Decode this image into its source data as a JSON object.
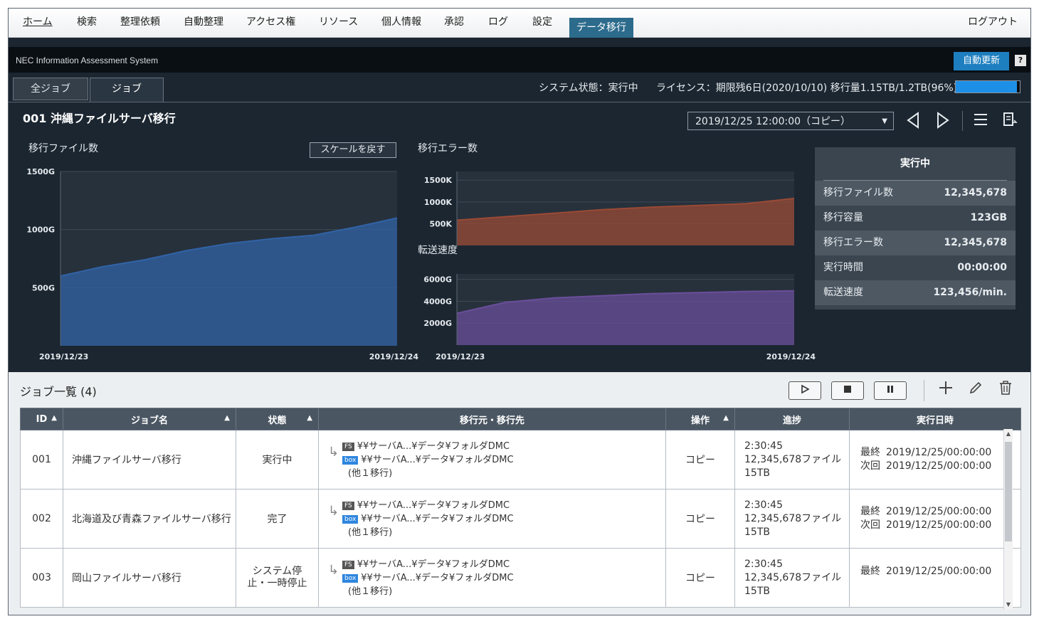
{
  "menu": {
    "items": [
      "ホーム",
      "検索",
      "整理依頼",
      "自動整理",
      "アクセス権",
      "リソース",
      "個人情報",
      "承認",
      "ログ",
      "設定",
      "データ移行"
    ],
    "active": "データ移行",
    "logout": "ログアウト"
  },
  "header": {
    "system_name": "NEC Information Assessment System",
    "auto_refresh": "自動更新",
    "help": "?",
    "tabs": [
      "全ジョブ",
      "ジョブ"
    ],
    "system_status": "システム状態：実行中",
    "license": "ライセンス：期限残6日(2020/10/10) 移行量1.15TB/1.2TB(96%)",
    "license_percent": 96
  },
  "job": {
    "title": "001 沖縄ファイルサーバ移行",
    "datetime_select": "2019/12/25 12:00:00（コピー）"
  },
  "charts": {
    "files_title": "移行ファイル数",
    "scale_reset": "スケールを戻す",
    "errors_title": "移行エラー数",
    "speed_title": "転送速度"
  },
  "chart_data": [
    {
      "type": "area",
      "title": "移行ファイル数",
      "x": [
        "2019/12/23",
        "",
        "",
        "",
        "",
        "",
        "",
        "",
        "2019/12/24"
      ],
      "yticks": [
        "500G",
        "1000G",
        "1500G"
      ],
      "ylim": [
        0,
        1500
      ],
      "series": [
        {
          "values": [
            600,
            680,
            740,
            820,
            880,
            920,
            950,
            1020,
            1100
          ]
        }
      ],
      "xtick_labels": [
        "2019/12/23",
        "2019/12/24"
      ],
      "color": "#3163a6"
    },
    {
      "type": "area",
      "title": "移行エラー数",
      "x": [
        "",
        "",
        "",
        "",
        "",
        "",
        "",
        ""
      ],
      "yticks": [
        "500K",
        "1000K",
        "1500K"
      ],
      "ylim": [
        0,
        1700
      ],
      "series": [
        {
          "values": [
            580,
            660,
            740,
            820,
            880,
            920,
            960,
            1080
          ]
        }
      ],
      "color": "#9a4a35"
    },
    {
      "type": "area",
      "title": "転送速度",
      "x": [
        "2019/12/23",
        "",
        "",
        "",
        "",
        "",
        "",
        "2019/12/24"
      ],
      "yticks": [
        "2000G",
        "4000G",
        "6000G"
      ],
      "ylim": [
        0,
        6500
      ],
      "series": [
        {
          "values": [
            2900,
            3900,
            4300,
            4500,
            4700,
            4800,
            4900,
            4950
          ]
        }
      ],
      "xtick_labels": [
        "2019/12/23",
        "2019/12/24"
      ],
      "color": "#6a4e9a"
    }
  ],
  "stats": {
    "status": "実行中",
    "rows": [
      {
        "label": "移行ファイル数",
        "value": "12,345,678"
      },
      {
        "label": "移行容量",
        "value": "123GB"
      },
      {
        "label": "移行エラー数",
        "value": "12,345,678"
      },
      {
        "label": "実行時間",
        "value": "00:00:00"
      },
      {
        "label": "転送速度",
        "value": "123,456/min."
      }
    ]
  },
  "list": {
    "title": "ジョブ一覧 (4)",
    "columns": [
      "ID",
      "ジョブ名",
      "状態",
      "移行元・移行先",
      "操作",
      "進捗",
      "実行日時"
    ],
    "rows": [
      {
        "id": "001",
        "name": "沖縄ファイルサーバ移行",
        "status": "実行中",
        "src": "¥¥サーバA...¥データ¥フォルダDMC",
        "dst": "¥¥サーバA...¥データ¥フォルダDMC",
        "more": "(他１移行)",
        "op": "コピー",
        "time": "2:30:45",
        "files": "12,345,678ファイル",
        "size": "15TB",
        "last_label": "最終",
        "last": "2019/12/25/00:00:00",
        "next_label": "次回",
        "next": "2019/12/25/00:00:00"
      },
      {
        "id": "002",
        "name": "北海道及び青森ファイルサーバ移行",
        "status": "完了",
        "src": "¥¥サーバA...¥データ¥フォルダDMC",
        "dst": "¥¥サーバA...¥データ¥フォルダDMC",
        "more": "(他１移行)",
        "op": "コピー",
        "time": "2:30:45",
        "files": "12,345,678ファイル",
        "size": "15TB",
        "last_label": "最終",
        "last": "2019/12/25/00:00:00",
        "next_label": "次回",
        "next": "2019/12/25/00:00:00"
      },
      {
        "id": "003",
        "name": "岡山ファイルサーバ移行",
        "status": "システム停止・一時停止",
        "src": "¥¥サーバA...¥データ¥フォルダDMC",
        "dst": "¥¥サーバA...¥データ¥フォルダDMC",
        "more": "(他１移行)",
        "op": "コピー",
        "time": "2:30:45",
        "files": "12,345,678ファイル",
        "size": "15TB",
        "last_label": "最終",
        "last": "2019/12/25/00:00:00",
        "next_label": "",
        "next": ""
      }
    ],
    "badge_fs": "FS",
    "badge_box": "box"
  }
}
